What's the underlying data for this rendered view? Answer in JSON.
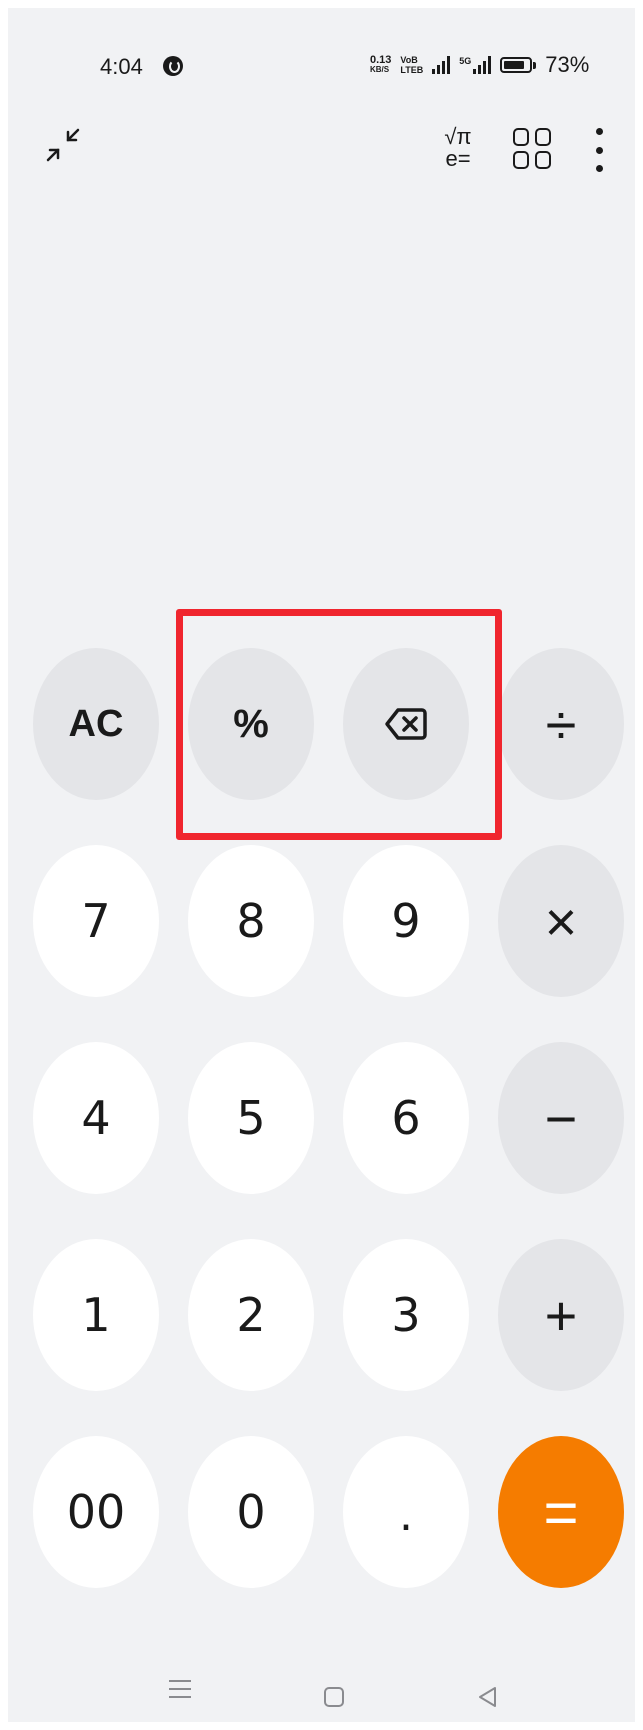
{
  "status_bar": {
    "time": "4:04",
    "net_speed_top": "0.13",
    "net_speed_bottom": "KB/S",
    "volte_top": "VoB",
    "volte_bottom": "LTEB",
    "sig2_label": "5G",
    "battery": "73%"
  },
  "toolbar": {
    "sci_top": "√π",
    "sci_bottom": "e="
  },
  "keypad": {
    "ac": "AC",
    "percent": "%",
    "divide": "÷",
    "seven": "7",
    "eight": "8",
    "nine": "9",
    "multiply": "×",
    "four": "4",
    "five": "5",
    "six": "6",
    "minus": "−",
    "one": "1",
    "two": "2",
    "three": "3",
    "plus": "+",
    "double_zero": "00",
    "zero": "0",
    "dot": ".",
    "equals": "="
  },
  "colors": {
    "accent": "#f57c00",
    "highlight": "#f0262e",
    "background": "#f1f2f4"
  }
}
